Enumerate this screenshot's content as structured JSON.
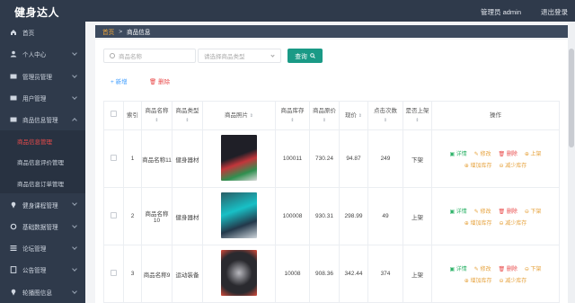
{
  "app": {
    "title": "健身达人",
    "admin_label": "管理员 admin",
    "logout": "退出登录"
  },
  "sidebar": {
    "items": [
      {
        "label": "首页",
        "icon": "home-icon",
        "has_children": false
      },
      {
        "label": "个人中心",
        "icon": "user-icon",
        "has_children": true
      },
      {
        "label": "管理员管理",
        "icon": "card-icon",
        "has_children": true
      },
      {
        "label": "用户管理",
        "icon": "card-icon",
        "has_children": true
      },
      {
        "label": "商品信息管理",
        "icon": "card-icon",
        "has_children": true
      }
    ],
    "sub_items": [
      {
        "label": "商品信息管理",
        "active": true
      },
      {
        "label": "商品信息评价管理",
        "active": false
      },
      {
        "label": "商品信息订单管理",
        "active": false
      }
    ],
    "items_after": [
      {
        "label": "健身课程管理",
        "icon": "pin-icon",
        "has_children": true
      },
      {
        "label": "基础数据管理",
        "icon": "refresh-icon",
        "has_children": true
      },
      {
        "label": "论坛管理",
        "icon": "list-icon",
        "has_children": true
      },
      {
        "label": "公告管理",
        "icon": "doc-icon",
        "has_children": true
      },
      {
        "label": "轮播图信息",
        "icon": "pin-icon",
        "has_children": true
      }
    ]
  },
  "breadcrumb": {
    "home": "首页",
    "separator": ">",
    "current": "商品信息"
  },
  "filters": {
    "search_placeholder": "商品名称",
    "type_placeholder": "请选择商品类型",
    "query_button": "查询"
  },
  "actions": {
    "add": "新增",
    "delete": "删除"
  },
  "table": {
    "headers": [
      "",
      "索引",
      "商品名称",
      "商品类型",
      "商品照片",
      "商品库存",
      "商品原价",
      "现价",
      "点击次数",
      "是否上架",
      "操作"
    ],
    "rows": [
      {
        "index": "1",
        "name": "商品名称11",
        "type": "健身器材",
        "stock": "100011",
        "original_price": "730.24",
        "price": "94.87",
        "clicks": "249",
        "status": "下架",
        "thumb_colors": [
          "#1f1f27",
          "#c2363b",
          "#2f8f4f"
        ],
        "actions": [
          "详情",
          "修改",
          "删除",
          "上架",
          "增加库存",
          "减少库存"
        ]
      },
      {
        "index": "2",
        "name": "商品名称10",
        "type": "健身器材",
        "stock": "100008",
        "original_price": "930.31",
        "price": "298.99",
        "clicks": "49",
        "status": "上架",
        "thumb_colors": [
          "#2a5e66",
          "#18c0c6",
          "#23384a"
        ],
        "actions": [
          "详情",
          "修改",
          "删除",
          "下架",
          "增加库存",
          "减少库存"
        ]
      },
      {
        "index": "3",
        "name": "商品名称9",
        "type": "运动装备",
        "stock": "10008",
        "original_price": "908.36",
        "price": "342.44",
        "clicks": "374",
        "status": "上架",
        "thumb_colors": [
          "#2a2a2f",
          "#d84b3a",
          "#b8b8be"
        ],
        "actions": [
          "详情",
          "修改",
          "删除",
          "下架",
          "增加库存",
          "减少库存"
        ]
      }
    ]
  },
  "colors": {
    "sidebar_bg": "#2f3a4b",
    "accent_red": "#e94b4b",
    "query_btn": "#1a9a86",
    "link_blue": "#409eff"
  }
}
